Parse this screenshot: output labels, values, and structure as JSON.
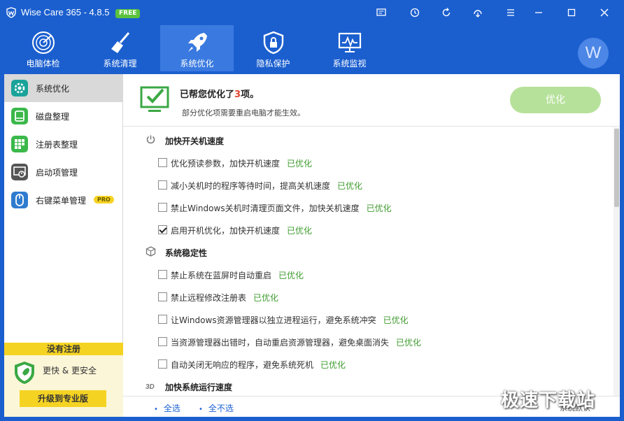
{
  "window": {
    "title": "Wise Care 365 - 4.8.5",
    "badge": "FREE"
  },
  "theme": {
    "primary": "#1b5fcf",
    "tab_active": "#3a7ae0",
    "success": "#3e9b2e",
    "accent_yellow": "#f5d323",
    "button_green": "#b6e19a"
  },
  "toolbar_icons": [
    "message-icon",
    "clock-icon",
    "refresh-icon",
    "undo-icon",
    "menu-icon"
  ],
  "nav": {
    "tabs": [
      {
        "label": "电脑体检",
        "icon": "radar-icon"
      },
      {
        "label": "系统清理",
        "icon": "broom-icon"
      },
      {
        "label": "系统优化",
        "icon": "rocket-icon",
        "active": true
      },
      {
        "label": "隐私保护",
        "icon": "shield-icon"
      },
      {
        "label": "系统监视",
        "icon": "monitor-chart-icon"
      }
    ],
    "avatar_letter": "W"
  },
  "sidebar": {
    "items": [
      {
        "label": "系统优化",
        "icon": "gear-icon",
        "active": true
      },
      {
        "label": "磁盘整理",
        "icon": "disk-icon"
      },
      {
        "label": "注册表整理",
        "icon": "grid-icon"
      },
      {
        "label": "启动项管理",
        "icon": "startup-icon"
      },
      {
        "label": "右键菜单管理",
        "icon": "mouse-icon",
        "badge": "PRO"
      }
    ],
    "promo": {
      "header": "没有注册",
      "text": "更快 & 更安全",
      "button": "升级到专业版"
    }
  },
  "summary": {
    "title_prefix": "已帮您优化了",
    "count": "3",
    "title_suffix": "项。",
    "subtitle": "部分优化项需要重启电脑才能生效。",
    "optimize_button": "优化"
  },
  "sections": [
    {
      "title": "加快开关机速度",
      "icon": "power-icon",
      "items": [
        {
          "text": "优化预读参数，加快开机速度",
          "status": "已优化",
          "checked": false
        },
        {
          "text": "减小关机时的程序等待时间，提高关机速度",
          "status": "已优化",
          "checked": false
        },
        {
          "text": "禁止Windows关机时清理页面文件，加快关机速度",
          "status": "已优化",
          "checked": false
        },
        {
          "text": "启用开机优化，加快开机速度",
          "status": "已优化",
          "checked": true
        }
      ]
    },
    {
      "title": "系统稳定性",
      "icon": "cube-icon",
      "items": [
        {
          "text": "禁止系统在蓝屏时自动重启",
          "status": "已优化",
          "checked": false
        },
        {
          "text": "禁止远程修改注册表",
          "status": "已优化",
          "checked": false
        },
        {
          "text": "让Windows资源管理器以独立进程运行，避免系统冲突",
          "status": "已优化",
          "checked": false
        },
        {
          "text": "当资源管理器出错时，自动重启资源管理器，避免桌面消失",
          "status": "已优化",
          "checked": false
        },
        {
          "text": "自动关闭无响应的程序，避免系统死机",
          "status": "已优化",
          "checked": false
        }
      ]
    },
    {
      "title": "加快系统运行速度",
      "icon": "speed-3d-icon",
      "items": []
    }
  ],
  "footer": {
    "select_all": "全选",
    "select_none": "全不选",
    "restore": "系统默认"
  },
  "watermark": "极速下载站"
}
